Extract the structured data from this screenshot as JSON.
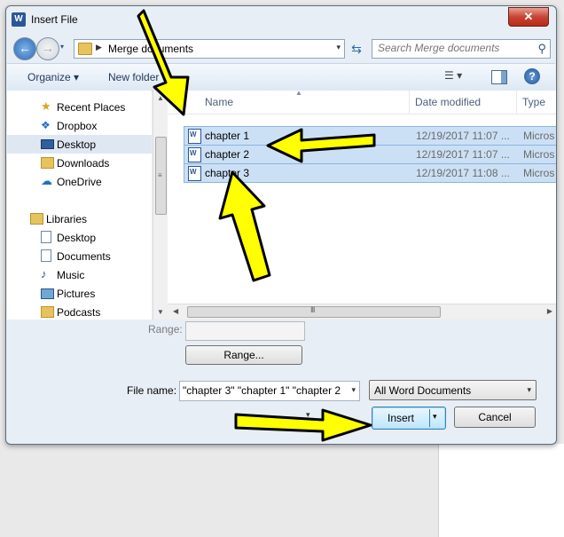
{
  "window": {
    "title": "Insert File",
    "app_icon": "W",
    "close_glyph": "✕"
  },
  "nav": {
    "back_glyph": "←",
    "forward_glyph": "→",
    "history_glyph": "▾",
    "breadcrumb_sep": "▶",
    "breadcrumb": "Merge documents",
    "address_drop_glyph": "▾",
    "refresh_glyph": "⇆",
    "search_placeholder": "Search Merge documents",
    "search_glyph": "⚲"
  },
  "toolbar": {
    "organize": "Organize ▾",
    "new_folder": "New folder",
    "view_glyph": "☰ ▾",
    "help_glyph": "?"
  },
  "sidebar": {
    "items": [
      {
        "label": "Recent Places",
        "icon": "recent-places-icon",
        "glyph": "★"
      },
      {
        "label": "Dropbox",
        "icon": "dropbox-icon",
        "glyph": "❖"
      },
      {
        "label": "Desktop",
        "icon": "desktop-icon",
        "selected": true
      },
      {
        "label": "Downloads",
        "icon": "folder-icon"
      },
      {
        "label": "OneDrive",
        "icon": "cloud-icon",
        "glyph": "☁"
      },
      {
        "label": "Libraries",
        "icon": "libraries-icon"
      },
      {
        "label": "Desktop",
        "icon": "desktop-icon"
      },
      {
        "label": "Documents",
        "icon": "document-icon"
      },
      {
        "label": "Music",
        "icon": "music-icon",
        "glyph": "♪"
      },
      {
        "label": "Pictures",
        "icon": "picture-icon"
      },
      {
        "label": "Podcasts",
        "icon": "folder-icon"
      }
    ]
  },
  "scroll": {
    "up_glyph": "▲",
    "down_glyph": "▼",
    "left_glyph": "◀",
    "right_glyph": "▶",
    "v_grip": "≡",
    "h_grip": "III"
  },
  "files": {
    "columns": {
      "name": "Name",
      "date": "Date modified",
      "type": "Type"
    },
    "rows": [
      {
        "name": "chapter 1",
        "date": "12/19/2017 11:07 ...",
        "type": "Micros"
      },
      {
        "name": "chapter 2",
        "date": "12/19/2017 11:07 ...",
        "type": "Micros"
      },
      {
        "name": "chapter 3",
        "date": "12/19/2017 11:08 ...",
        "type": "Micros"
      }
    ]
  },
  "form": {
    "range_label": "Range:",
    "range_value": "",
    "range_button": "Range...",
    "filename_label": "File name:",
    "filename_value": "\"chapter 3\" \"chapter 1\" \"chapter 2",
    "filename_drop_glyph": "▾",
    "filter_value": "All Word Documents",
    "filter_drop_glyph": "▾",
    "tools_drop_glyph": "▾",
    "insert_label": "Insert",
    "insert_drop_glyph": "▾",
    "cancel_label": "Cancel"
  },
  "annotations": {
    "arrow_fill": "#ffff00",
    "arrow_stroke": "#000000"
  }
}
